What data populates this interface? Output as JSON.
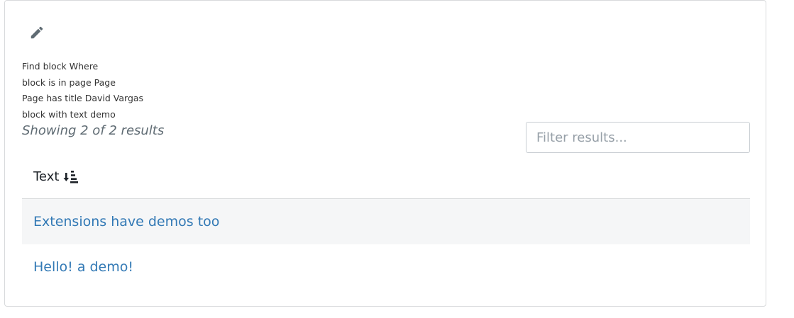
{
  "query": {
    "lines": [
      "Find block Where",
      "block is in page Page",
      "Page has title David Vargas",
      "block with text demo"
    ]
  },
  "results": {
    "count_text": "Showing 2 of 2 results"
  },
  "filter": {
    "placeholder": "Filter results..."
  },
  "table": {
    "column_header": "Text",
    "rows": [
      {
        "text": "Extensions have demos too"
      },
      {
        "text": "Hello! a demo!"
      }
    ]
  },
  "colors": {
    "link": "#3279b5",
    "row_alt_bg": "#f5f6f7",
    "border": "#d8dadc"
  },
  "icons": {
    "edit": "pencil-icon",
    "sort": "sort-descending-icon"
  }
}
